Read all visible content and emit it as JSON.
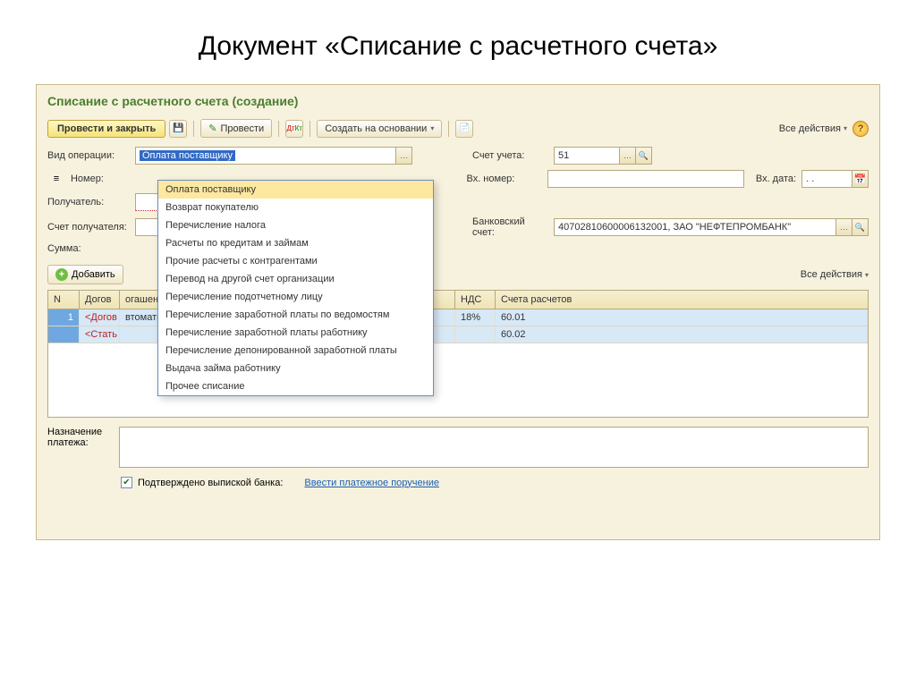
{
  "slide": {
    "title": "Документ «Списание с расчетного счета»"
  },
  "form": {
    "title": "Списание с расчетного счета (создание)"
  },
  "toolbar": {
    "post_close": "Провести и закрыть",
    "post": "Провести",
    "create_based": "Создать на основании",
    "all_actions": "Все действия"
  },
  "labels": {
    "operation": "Вид операции:",
    "number": "Номер:",
    "recipient": "Получатель:",
    "recipient_account": "Счет получателя:",
    "sum": "Сумма:",
    "account": "Счет учета:",
    "incoming_number": "Вх. номер:",
    "incoming_date": "Вх. дата:",
    "bank_account": "Банковский счет:",
    "purpose": "Назначение платежа:",
    "confirmed": "Подтверждено выпиской банка:"
  },
  "fields": {
    "operation_value": "Оплата поставщику",
    "account_value": "51",
    "incoming_date_value": ". .",
    "bank_account_value": "40702810600006132001, ЗАО \"НЕФТЕПРОМБАНК\""
  },
  "dropdown": {
    "items": [
      "Оплата поставщику",
      "Возврат покупателю",
      "Перечисление налога",
      "Расчеты по кредитам и займам",
      "Прочие расчеты с контрагентами",
      "Перевод на другой счет организации",
      "Перечисление подотчетному лицу",
      "Перечисление заработной платы по ведомостям",
      "Перечисление заработной платы работнику",
      "Перечисление депонированной заработной платы",
      "Выдача займа работнику",
      "Прочее списание"
    ]
  },
  "add_btn": "Добавить",
  "grid": {
    "headers": {
      "n": "N",
      "dog": "Догов",
      "pog": "огашение задолженности",
      "nds": "НДС",
      "sch": "Счета расчетов"
    },
    "rows": [
      {
        "n": "1",
        "dog": "<Догов",
        "pog": "втоматически",
        "nds": "18%",
        "sch": "60.01"
      },
      {
        "dog": "<Стать",
        "sch": "60.02"
      }
    ]
  },
  "link": {
    "enter_payment": "Ввести платежное поручение"
  }
}
